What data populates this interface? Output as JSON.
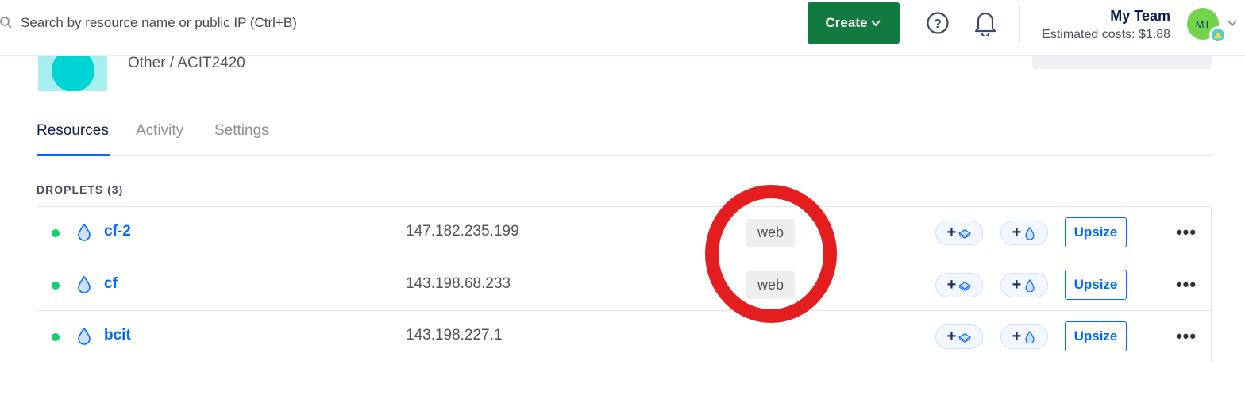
{
  "search": {
    "placeholder": "Search by resource name or public IP (Ctrl+B)"
  },
  "topbar": {
    "create_label": "Create",
    "team_name": "My Team",
    "estimated_costs": "Estimated costs: $1.88",
    "avatar_initials": "MT"
  },
  "project": {
    "path": "Other / ACIT2420"
  },
  "tabs": [
    {
      "label": "Resources",
      "active": true
    },
    {
      "label": "Activity",
      "active": false
    },
    {
      "label": "Settings",
      "active": false
    }
  ],
  "droplets": {
    "title": "DROPLETS (3)",
    "rows": [
      {
        "name": "cf-2",
        "ip": "147.182.235.199",
        "tag": "web",
        "status": "active",
        "upsize_label": "Upsize",
        "add_volume": "+",
        "add_snapshot": "+"
      },
      {
        "name": "cf",
        "ip": "143.198.68.233",
        "tag": "web",
        "status": "active",
        "upsize_label": "Upsize",
        "add_volume": "+",
        "add_snapshot": "+"
      },
      {
        "name": "bcit",
        "ip": "143.198.227.1",
        "tag": "",
        "status": "active",
        "upsize_label": "Upsize",
        "add_volume": "+",
        "add_snapshot": "+"
      }
    ]
  },
  "colors": {
    "create_button": "#137a3f",
    "link_blue": "#0069ff",
    "status_green": "#15cd72",
    "annotation_red": "#e41e1e"
  },
  "icons": {
    "search": "search-icon",
    "help": "help-icon",
    "bell": "bell-icon",
    "droplet": "droplet-icon",
    "volume": "volume-icon",
    "snapshot": "snapshot-icon",
    "more": "more-icon"
  }
}
